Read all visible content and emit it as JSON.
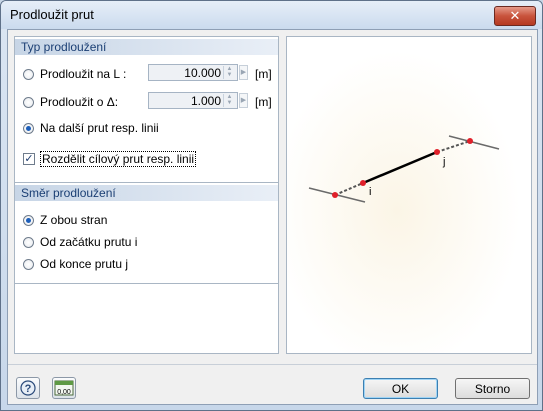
{
  "window": {
    "title": "Prodloužit prut",
    "close_label": "✕"
  },
  "extension_type": {
    "header": "Typ prodloužení",
    "options": [
      {
        "label": "Prodloužit na L :",
        "value": "10.000",
        "unit": "[m]",
        "checked": false
      },
      {
        "label": "Prodloužit o Δ:",
        "value": "1.000",
        "unit": "[m]",
        "checked": false
      },
      {
        "label": "Na další prut resp. linii",
        "checked": true
      }
    ],
    "split_checkbox": {
      "label": "Rozdělit cílový prut resp. linii",
      "checked": true
    }
  },
  "direction": {
    "header": "Směr prodloužení",
    "options": [
      {
        "label": "Z obou stran",
        "checked": true
      },
      {
        "label": "Od začátku prutu i",
        "checked": false
      },
      {
        "label": "Od konce prutu j",
        "checked": false
      }
    ]
  },
  "preview": {
    "node_i_label": "i",
    "node_j_label": "j",
    "colors": {
      "member": "#000000",
      "node": "#e0202a",
      "line": "#6a6a6a"
    }
  },
  "footer": {
    "help_icon": "help-icon",
    "units_icon": "units-icon",
    "units_icon_text": "0,00",
    "ok_label": "OK",
    "cancel_label": "Storno"
  }
}
